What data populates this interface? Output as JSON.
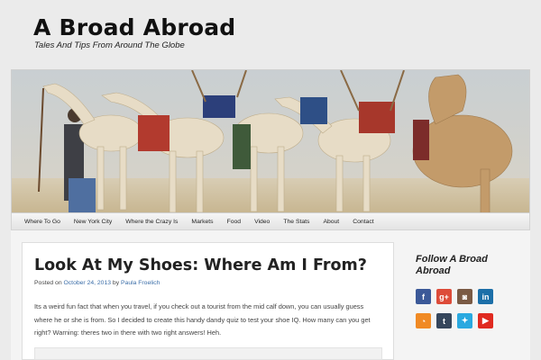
{
  "site": {
    "title": "A Broad Abroad",
    "tagline": "Tales And Tips From Around The Globe"
  },
  "hero": {
    "alt": "camels"
  },
  "nav": {
    "items": [
      "Where To Go",
      "New York City",
      "Where the Crazy Is",
      "Markets",
      "Food",
      "Video",
      "The Stats",
      "About",
      "Contact"
    ]
  },
  "post": {
    "title": "Look At My Shoes: Where Am I From?",
    "meta": {
      "posted_on": "Posted on",
      "date": "October 24, 2013",
      "by": "by",
      "author": "Paula Froelich"
    },
    "body": "Its a weird fun fact that when you travel, if you check out a tourist from the mid calf down, you can usually guess where he or she is from. So I decided to create this handy dandy quiz to test your shoe IQ. How many can you get right? Warning: theres two in there with two right answers! Heh."
  },
  "sidebar": {
    "follow_title": "Follow A Broad Abroad",
    "social": [
      {
        "name": "facebook-icon",
        "glyph": "f",
        "color": "#3b5998"
      },
      {
        "name": "google-plus-icon",
        "glyph": "g+",
        "color": "#dd4b39"
      },
      {
        "name": "instagram-icon",
        "glyph": "◙",
        "color": "#7a5a44"
      },
      {
        "name": "linkedin-icon",
        "glyph": "in",
        "color": "#1c6fa8"
      },
      {
        "name": "rss-icon",
        "glyph": "◔",
        "color": "#f08a24"
      },
      {
        "name": "tumblr-icon",
        "glyph": "t",
        "color": "#35465c"
      },
      {
        "name": "twitter-icon",
        "glyph": "✦",
        "color": "#2aa9e0"
      },
      {
        "name": "youtube-icon",
        "glyph": "▶",
        "color": "#e02a20"
      }
    ]
  }
}
